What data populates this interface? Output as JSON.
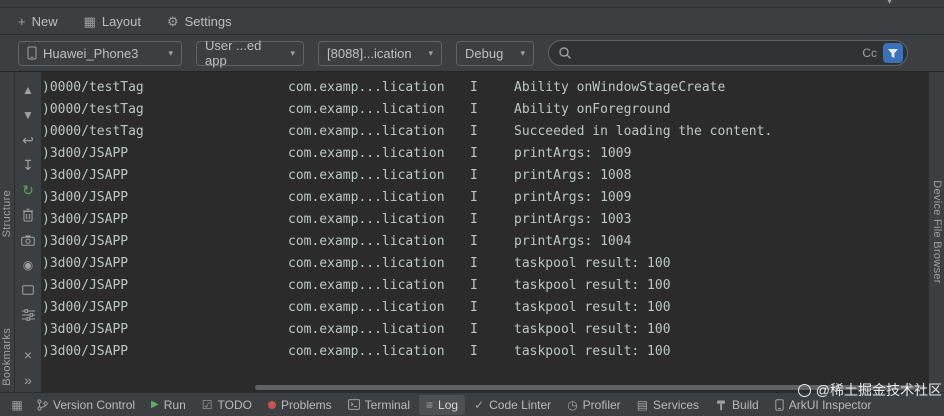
{
  "colors": {
    "accent_blue": "#3b71b8",
    "green": "#57a65c",
    "red": "#c75450"
  },
  "glyphs": {
    "plus": "+",
    "grid": "▦",
    "gear": "⚙",
    "caret": "▾",
    "up": "▲",
    "down": "▼",
    "soft_wrap": "↩",
    "scroll_end": "↧",
    "restart": "↻",
    "record": "◉",
    "close": "×",
    "expand": "»",
    "play": "▶",
    "todo": "☑",
    "log_lines": "≡",
    "check": "✓",
    "clock": "◷",
    "services": "▤",
    "switcher": "▦"
  },
  "quick_toolbar": {
    "new": "New",
    "layout": "Layout",
    "settings": "Settings"
  },
  "run_bar": {
    "device": "Huawei_Phone3",
    "app": "User ...ed app",
    "process": "[8088]...ication",
    "level": "Debug",
    "search_value": "",
    "match_case": "Cc"
  },
  "panels": {
    "left_top": "Structure",
    "left_bottom": "Bookmarks",
    "right": "Device File Browser"
  },
  "log_toolbar_icons": [
    "scroll-up",
    "scroll-down",
    "soft-wrap",
    "scroll-to-end",
    "restart",
    "clear-log",
    "screenshot",
    "screen-record",
    "device-frame",
    "log-filter",
    "close",
    "expand"
  ],
  "log": {
    "rows": [
      {
        "tag": ")0000/testTag",
        "package": "com.examp...lication",
        "level": "I",
        "message": "Ability onWindowStageCreate"
      },
      {
        "tag": ")0000/testTag",
        "package": "com.examp...lication",
        "level": "I",
        "message": "Ability onForeground"
      },
      {
        "tag": ")0000/testTag",
        "package": "com.examp...lication",
        "level": "I",
        "message": "Succeeded in loading the content."
      },
      {
        "tag": ")3d00/JSAPP",
        "package": "com.examp...lication",
        "level": "I",
        "message": "printArgs: 1009"
      },
      {
        "tag": ")3d00/JSAPP",
        "package": "com.examp...lication",
        "level": "I",
        "message": "printArgs: 1008"
      },
      {
        "tag": ")3d00/JSAPP",
        "package": "com.examp...lication",
        "level": "I",
        "message": "printArgs: 1009"
      },
      {
        "tag": ")3d00/JSAPP",
        "package": "com.examp...lication",
        "level": "I",
        "message": "printArgs: 1003"
      },
      {
        "tag": ")3d00/JSAPP",
        "package": "com.examp...lication",
        "level": "I",
        "message": "printArgs: 1004"
      },
      {
        "tag": ")3d00/JSAPP",
        "package": "com.examp...lication",
        "level": "I",
        "message": "taskpool result: 100"
      },
      {
        "tag": ")3d00/JSAPP",
        "package": "com.examp...lication",
        "level": "I",
        "message": "taskpool result: 100"
      },
      {
        "tag": ")3d00/JSAPP",
        "package": "com.examp...lication",
        "level": "I",
        "message": "taskpool result: 100"
      },
      {
        "tag": ")3d00/JSAPP",
        "package": "com.examp...lication",
        "level": "I",
        "message": "taskpool result: 100"
      },
      {
        "tag": ")3d00/JSAPP",
        "package": "com.examp...lication",
        "level": "I",
        "message": "taskpool result: 100"
      }
    ]
  },
  "status_bar": {
    "items": [
      {
        "icon": "git-branch-icon",
        "label": "Version Control"
      },
      {
        "icon": "run-icon",
        "label": "Run"
      },
      {
        "icon": "todo-icon",
        "label": "TODO"
      },
      {
        "icon": "problems-icon",
        "label": "Problems"
      },
      {
        "icon": "terminal-icon",
        "label": "Terminal"
      },
      {
        "icon": "log-icon",
        "label": "Log",
        "selected": true
      },
      {
        "icon": "code-linter-icon",
        "label": "Code Linter"
      },
      {
        "icon": "profiler-icon",
        "label": "Profiler"
      },
      {
        "icon": "services-icon",
        "label": "Services"
      },
      {
        "icon": "build-icon",
        "label": "Build"
      },
      {
        "icon": "arkui-inspector-icon",
        "label": "ArkUI Inspector"
      }
    ]
  },
  "watermark": "@稀土掘金技术社区"
}
